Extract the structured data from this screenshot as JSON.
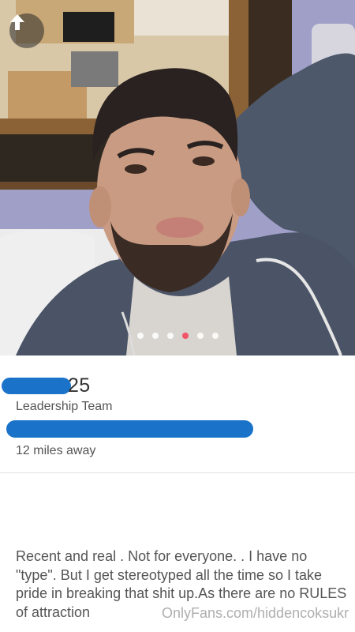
{
  "profile": {
    "age": "25",
    "job_title": "Leadership Team",
    "distance": "12 miles away",
    "bio": "Recent and real . Not for everyone.  . I have no \"type\". But I get stereotyped all the time so I take pride in breaking that shit up.As there are no RULES of attraction"
  },
  "photo": {
    "icon": "arrow-up-icon",
    "dots_count": 6,
    "active_dot_index": 3
  },
  "watermark": "OnlyFans.com/hiddencoksukr",
  "colors": {
    "redaction": "#1a73c8",
    "active_dot": "#f2546a",
    "wall": "#9d9cc4"
  }
}
